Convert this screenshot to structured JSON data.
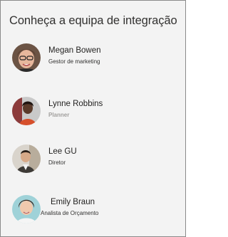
{
  "title": "Conheça a equipa de integração",
  "people": [
    {
      "name": "Megan Bowen",
      "role": "Gestor de marketing",
      "avatar_icon": "person-photo"
    },
    {
      "name": "Lynne Robbins",
      "role": "Planner",
      "avatar_icon": "person-photo"
    },
    {
      "name": "Lee GU",
      "role": "Diretor",
      "avatar_icon": "person-photo"
    },
    {
      "name": "Emily Braun",
      "role": "Analista de Orçamento",
      "avatar_icon": "person-photo"
    }
  ]
}
